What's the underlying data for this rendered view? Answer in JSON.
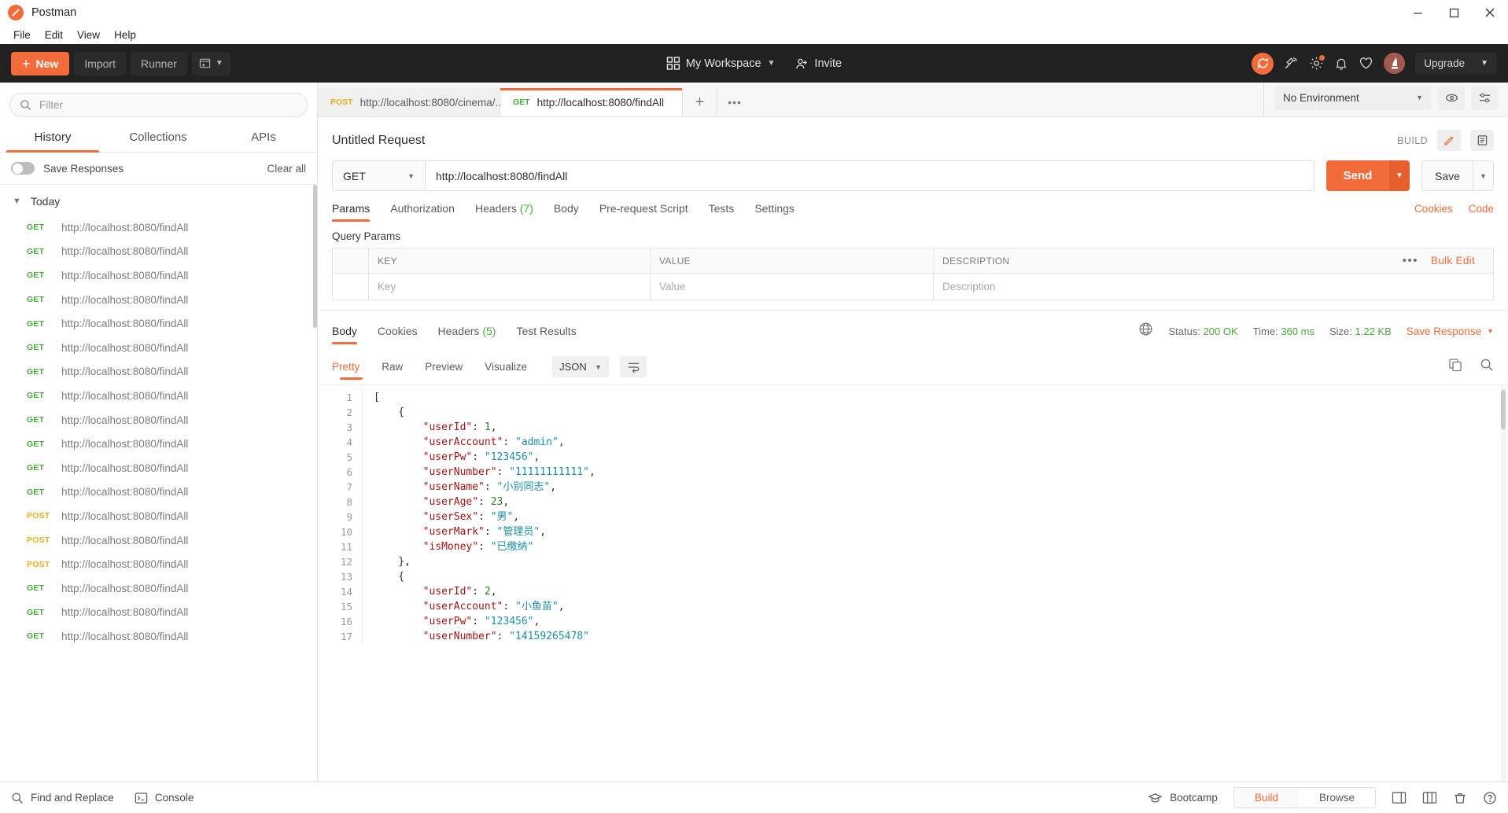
{
  "window": {
    "title": "Postman",
    "logo_icon": "postman-logo-icon",
    "minimize_icon": "minimize-icon",
    "maximize_icon": "maximize-icon",
    "close_icon": "close-icon"
  },
  "menubar": {
    "items": [
      "File",
      "Edit",
      "View",
      "Help"
    ]
  },
  "toolbar": {
    "new_label": "New",
    "import_label": "Import",
    "runner_label": "Runner",
    "new_window_icon": "new-window-icon",
    "workspace_label": "My Workspace",
    "workspace_icon": "grid-icon",
    "invite_label": "Invite",
    "invite_icon": "person-add-icon",
    "sync_icon": "sync-icon",
    "satellite_icon": "satellite-icon",
    "settings_icon": "gear-icon",
    "notifications_icon": "bell-icon",
    "heart_icon": "heart-icon",
    "avatar_icon": "user-avatar",
    "upgrade_label": "Upgrade",
    "accent_color": "#f26b3a"
  },
  "sidebar": {
    "filter_placeholder": "Filter",
    "search_icon": "search-icon",
    "tabs": [
      {
        "label": "History",
        "active": true
      },
      {
        "label": "Collections",
        "active": false
      },
      {
        "label": "APIs",
        "active": false
      }
    ],
    "save_responses_label": "Save Responses",
    "save_responses_on": false,
    "clear_all_label": "Clear all",
    "group_label": "Today",
    "group_chevron_icon": "chevron-down-icon",
    "history": [
      {
        "method": "GET",
        "url": "http://localhost:8080/findAll"
      },
      {
        "method": "GET",
        "url": "http://localhost:8080/findAll"
      },
      {
        "method": "GET",
        "url": "http://localhost:8080/findAll"
      },
      {
        "method": "GET",
        "url": "http://localhost:8080/findAll"
      },
      {
        "method": "GET",
        "url": "http://localhost:8080/findAll"
      },
      {
        "method": "GET",
        "url": "http://localhost:8080/findAll"
      },
      {
        "method": "GET",
        "url": "http://localhost:8080/findAll"
      },
      {
        "method": "GET",
        "url": "http://localhost:8080/findAll"
      },
      {
        "method": "GET",
        "url": "http://localhost:8080/findAll"
      },
      {
        "method": "GET",
        "url": "http://localhost:8080/findAll"
      },
      {
        "method": "GET",
        "url": "http://localhost:8080/findAll"
      },
      {
        "method": "GET",
        "url": "http://localhost:8080/findAll"
      },
      {
        "method": "POST",
        "url": "http://localhost:8080/findAll"
      },
      {
        "method": "POST",
        "url": "http://localhost:8080/findAll"
      },
      {
        "method": "POST",
        "url": "http://localhost:8080/findAll"
      },
      {
        "method": "GET",
        "url": "http://localhost:8080/findAll"
      },
      {
        "method": "GET",
        "url": "http://localhost:8080/findAll"
      },
      {
        "method": "GET",
        "url": "http://localhost:8080/findAll"
      }
    ]
  },
  "request_tabs": {
    "items": [
      {
        "method": "POST",
        "url": "http://localhost:8080/cinema/...",
        "unsaved": true,
        "active": false
      },
      {
        "method": "GET",
        "url": "http://localhost:8080/findAll",
        "unsaved": true,
        "active": true
      }
    ],
    "add_icon": "plus-icon",
    "more_icon": "ellipsis-icon"
  },
  "environment": {
    "selected": "No Environment",
    "caret_icon": "chevron-down-icon",
    "eye_icon": "eye-icon",
    "settings_icon": "sliders-icon"
  },
  "request": {
    "title": "Untitled Request",
    "build_label": "BUILD",
    "edit_icon": "pencil-icon",
    "comment_icon": "document-icon",
    "method": "GET",
    "url": "http://localhost:8080/findAll",
    "send_label": "Send",
    "send_caret_icon": "chevron-down-icon",
    "save_label": "Save",
    "save_caret_icon": "chevron-down-icon",
    "tabs": [
      {
        "label": "Params",
        "count": "",
        "active": true
      },
      {
        "label": "Authorization",
        "count": "",
        "active": false
      },
      {
        "label": "Headers",
        "count": "(7)",
        "active": false
      },
      {
        "label": "Body",
        "count": "",
        "active": false
      },
      {
        "label": "Pre-request Script",
        "count": "",
        "active": false
      },
      {
        "label": "Tests",
        "count": "",
        "active": false
      },
      {
        "label": "Settings",
        "count": "",
        "active": false
      }
    ],
    "cookies_label": "Cookies",
    "code_label": "Code",
    "query_params_title": "Query Params",
    "param_headers": [
      "KEY",
      "VALUE",
      "DESCRIPTION"
    ],
    "param_placeholders": [
      "Key",
      "Value",
      "Description"
    ],
    "bulk_edit_label": "Bulk Edit",
    "params_more_icon": "ellipsis-icon"
  },
  "response": {
    "tabs": [
      {
        "label": "Body",
        "count": "",
        "active": true
      },
      {
        "label": "Cookies",
        "count": "",
        "active": false
      },
      {
        "label": "Headers",
        "count": "(5)",
        "active": false
      },
      {
        "label": "Test Results",
        "count": "",
        "active": false
      }
    ],
    "globe_icon": "globe-icon",
    "status_label": "Status:",
    "status_value": "200 OK",
    "time_label": "Time:",
    "time_value": "360 ms",
    "size_label": "Size:",
    "size_value": "1.22 KB",
    "save_response_label": "Save Response",
    "save_response_caret_icon": "chevron-down-icon",
    "view_tabs": [
      {
        "label": "Pretty",
        "active": true
      },
      {
        "label": "Raw",
        "active": false
      },
      {
        "label": "Preview",
        "active": false
      },
      {
        "label": "Visualize",
        "active": false
      }
    ],
    "format": "JSON",
    "format_caret_icon": "chevron-down-icon",
    "wrap_icon": "word-wrap-icon",
    "copy_icon": "copy-icon",
    "search_icon": "search-icon",
    "body_lines": [
      {
        "n": 1,
        "tokens": [
          {
            "t": "p",
            "v": "["
          }
        ]
      },
      {
        "n": 2,
        "tokens": [
          {
            "t": "p",
            "v": "    {"
          }
        ]
      },
      {
        "n": 3,
        "tokens": [
          {
            "t": "k",
            "v": "        \"userId\""
          },
          {
            "t": "p",
            "v": ": "
          },
          {
            "t": "n",
            "v": "1"
          },
          {
            "t": "p",
            "v": ","
          }
        ]
      },
      {
        "n": 4,
        "tokens": [
          {
            "t": "k",
            "v": "        \"userAccount\""
          },
          {
            "t": "p",
            "v": ": "
          },
          {
            "t": "s",
            "v": "\"admin\""
          },
          {
            "t": "p",
            "v": ","
          }
        ]
      },
      {
        "n": 5,
        "tokens": [
          {
            "t": "k",
            "v": "        \"userPw\""
          },
          {
            "t": "p",
            "v": ": "
          },
          {
            "t": "s",
            "v": "\"123456\""
          },
          {
            "t": "p",
            "v": ","
          }
        ]
      },
      {
        "n": 6,
        "tokens": [
          {
            "t": "k",
            "v": "        \"userNumber\""
          },
          {
            "t": "p",
            "v": ": "
          },
          {
            "t": "s",
            "v": "\"11111111111\""
          },
          {
            "t": "p",
            "v": ","
          }
        ]
      },
      {
        "n": 7,
        "tokens": [
          {
            "t": "k",
            "v": "        \"userName\""
          },
          {
            "t": "p",
            "v": ": "
          },
          {
            "t": "s",
            "v": "\"小别同志\""
          },
          {
            "t": "p",
            "v": ","
          }
        ]
      },
      {
        "n": 8,
        "tokens": [
          {
            "t": "k",
            "v": "        \"userAge\""
          },
          {
            "t": "p",
            "v": ": "
          },
          {
            "t": "n",
            "v": "23"
          },
          {
            "t": "p",
            "v": ","
          }
        ]
      },
      {
        "n": 9,
        "tokens": [
          {
            "t": "k",
            "v": "        \"userSex\""
          },
          {
            "t": "p",
            "v": ": "
          },
          {
            "t": "s",
            "v": "\"男\""
          },
          {
            "t": "p",
            "v": ","
          }
        ]
      },
      {
        "n": 10,
        "tokens": [
          {
            "t": "k",
            "v": "        \"userMark\""
          },
          {
            "t": "p",
            "v": ": "
          },
          {
            "t": "s",
            "v": "\"管理员\""
          },
          {
            "t": "p",
            "v": ","
          }
        ]
      },
      {
        "n": 11,
        "tokens": [
          {
            "t": "k",
            "v": "        \"isMoney\""
          },
          {
            "t": "p",
            "v": ": "
          },
          {
            "t": "s",
            "v": "\"已缴纳\""
          }
        ]
      },
      {
        "n": 12,
        "tokens": [
          {
            "t": "p",
            "v": "    },"
          }
        ]
      },
      {
        "n": 13,
        "tokens": [
          {
            "t": "p",
            "v": "    {"
          }
        ]
      },
      {
        "n": 14,
        "tokens": [
          {
            "t": "k",
            "v": "        \"userId\""
          },
          {
            "t": "p",
            "v": ": "
          },
          {
            "t": "n",
            "v": "2"
          },
          {
            "t": "p",
            "v": ","
          }
        ]
      },
      {
        "n": 15,
        "tokens": [
          {
            "t": "k",
            "v": "        \"userAccount\""
          },
          {
            "t": "p",
            "v": ": "
          },
          {
            "t": "s",
            "v": "\"小鱼苗\""
          },
          {
            "t": "p",
            "v": ","
          }
        ]
      },
      {
        "n": 16,
        "tokens": [
          {
            "t": "k",
            "v": "        \"userPw\""
          },
          {
            "t": "p",
            "v": ": "
          },
          {
            "t": "s",
            "v": "\"123456\""
          },
          {
            "t": "p",
            "v": ","
          }
        ]
      },
      {
        "n": 17,
        "tokens": [
          {
            "t": "k",
            "v": "        \"userNumber\""
          },
          {
            "t": "p",
            "v": ": "
          },
          {
            "t": "s",
            "v": "\"14159265478\""
          }
        ]
      }
    ]
  },
  "statusbar": {
    "find_replace_label": "Find and Replace",
    "find_replace_icon": "search-icon",
    "console_label": "Console",
    "console_icon": "terminal-icon",
    "bootcamp_label": "Bootcamp",
    "bootcamp_icon": "bootcamp-icon",
    "build_label": "Build",
    "browse_label": "Browse",
    "layout_icon": "sidebar-layout-icon",
    "two-pane_icon": "two-pane-icon",
    "trash_icon": "trash-icon",
    "help_icon": "help-icon"
  }
}
